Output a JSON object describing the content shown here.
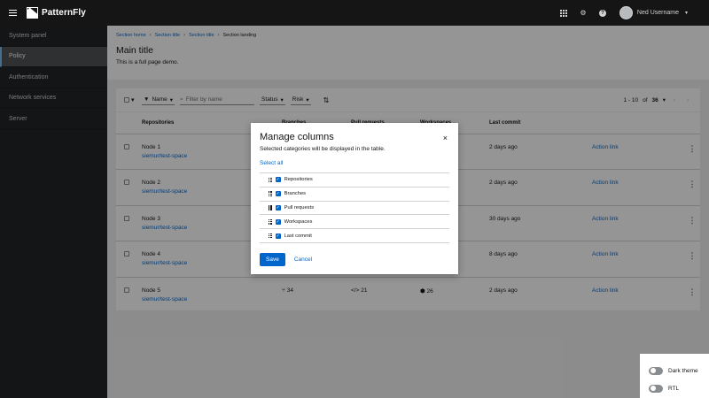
{
  "masthead": {
    "brand": "PatternFly",
    "user_name": "Ned Username"
  },
  "sidebar": {
    "items": [
      {
        "label": "System panel"
      },
      {
        "label": "Policy"
      },
      {
        "label": "Authentication"
      },
      {
        "label": "Network services"
      },
      {
        "label": "Server"
      }
    ],
    "active_index": 1
  },
  "page": {
    "breadcrumb": [
      "Section home",
      "Section title",
      "Section title",
      "Section landing"
    ],
    "title": "Main title",
    "subtitle": "This is a full page demo."
  },
  "toolbar": {
    "filter_name": "Name",
    "search_placeholder": "Filter by name",
    "status": "Status",
    "risk": "Risk",
    "pagination": {
      "range": "1 - 10",
      "of": "of",
      "total": "36"
    }
  },
  "table": {
    "headers": [
      "Repositories",
      "Branches",
      "Pull requests",
      "Workspaces",
      "Last commit"
    ],
    "rows": [
      {
        "name": "Node 1",
        "repo": "siemur/test-space",
        "branches": "",
        "prs": "",
        "workspaces": "",
        "last_commit": "2 days ago",
        "action": "Action link"
      },
      {
        "name": "Node 2",
        "repo": "siemur/test-space",
        "branches": "",
        "prs": "",
        "workspaces": "",
        "last_commit": "2 days ago",
        "action": "Action link"
      },
      {
        "name": "Node 3",
        "repo": "siemur/test-space",
        "branches": "",
        "prs": "",
        "workspaces": "",
        "last_commit": "30 days ago",
        "action": "Action link"
      },
      {
        "name": "Node 4",
        "repo": "siemur/test-space",
        "branches": "",
        "prs": "",
        "workspaces": "",
        "last_commit": "8 days ago",
        "action": "Action link"
      },
      {
        "name": "Node 5",
        "repo": "siemur/test-space",
        "branches": "34",
        "prs": "21",
        "workspaces": "26",
        "last_commit": "2 days ago",
        "action": "Action link"
      }
    ]
  },
  "modal": {
    "title": "Manage columns",
    "description": "Selected categories will be displayed in the table.",
    "select_all": "Select all",
    "columns": [
      {
        "label": "Repositories",
        "checked": true
      },
      {
        "label": "Branches",
        "checked": true
      },
      {
        "label": "Pull requests",
        "checked": true
      },
      {
        "label": "Workspaces",
        "checked": true
      },
      {
        "label": "Last commit",
        "checked": true
      }
    ],
    "save_label": "Save",
    "cancel_label": "Cancel",
    "close_glyph": "×"
  },
  "theme_switcher": {
    "dark_theme_label": "Dark theme",
    "rtl_label": "RTL",
    "dark_theme_on": false,
    "rtl_on": false
  },
  "icons": {
    "branch": "code-branch-icon",
    "pr": "code-icon",
    "workspace": "cube-icon"
  }
}
